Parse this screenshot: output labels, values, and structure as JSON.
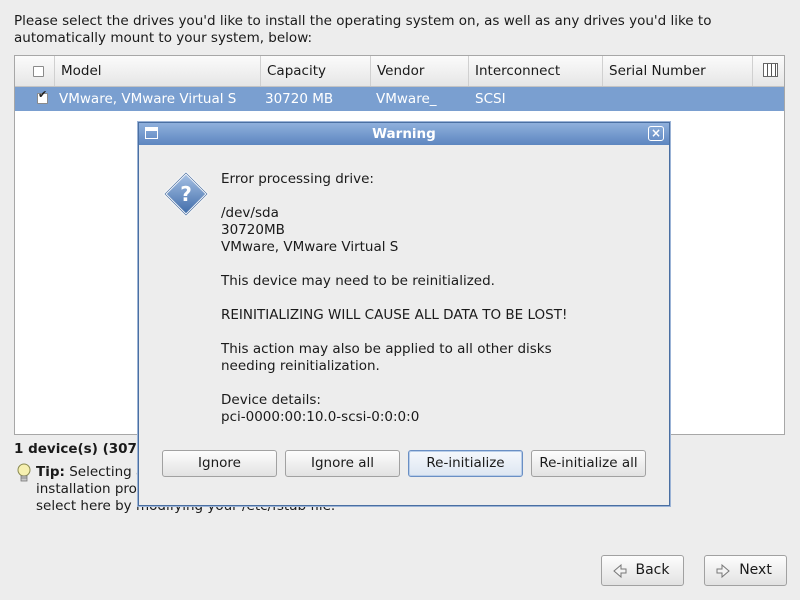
{
  "intro_text": "Please select the drives you'd like to install the operating system on, as well as any drives you'd like to automatically mount to your system, below:",
  "table": {
    "columns": [
      "Model",
      "Capacity",
      "Vendor",
      "Interconnect",
      "Serial Number"
    ],
    "rows": [
      {
        "checked": true,
        "model": "VMware, VMware Virtual S",
        "capacity": "30720 MB",
        "vendor": "VMware_",
        "interconnect": "SCSI",
        "serial": ""
      }
    ],
    "column_chooser_icon": "columns-icon"
  },
  "summary": "1 device(s) (307",
  "tip": {
    "label": "Tip:",
    "text_line1": "Selecting a",
    "text_line2": "installation proc",
    "text_line3": "select here by modifying your /etc/fstab file."
  },
  "buttons": {
    "back": "Back",
    "next": "Next"
  },
  "dialog": {
    "title": "Warning",
    "icon": "question-icon",
    "line_error": "Error processing drive:",
    "device_path": "/dev/sda",
    "device_size": "30720MB",
    "device_model": "VMware, VMware Virtual S",
    "line_reinit": "This device may need to be reinitialized.",
    "line_warning": "REINITIALIZING WILL CAUSE ALL DATA TO BE LOST!",
    "line_apply_1": "This action may also be applied to all other disks",
    "line_apply_2": "needing reinitialization.",
    "details_label": "Device details:",
    "details_value": "pci-0000:00:10.0-scsi-0:0:0:0",
    "buttons": [
      "Ignore",
      "Ignore all",
      "Re-initialize",
      "Re-initialize all"
    ]
  }
}
